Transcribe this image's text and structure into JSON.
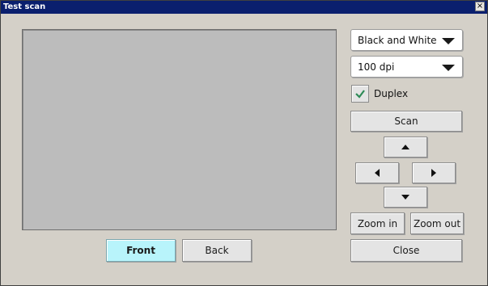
{
  "window": {
    "title": "Test scan",
    "close_glyph": "×"
  },
  "preview": {
    "label": "scan-preview-area"
  },
  "controls": {
    "color_mode": {
      "selected": "Black and White"
    },
    "resolution": {
      "selected": "100 dpi"
    },
    "duplex": {
      "label": "Duplex",
      "checked": true,
      "check_color": "#2e8b57"
    },
    "scan_label": "Scan",
    "zoom_in_label": "Zoom in",
    "zoom_out_label": "Zoom out",
    "close_label": "Close"
  },
  "side_buttons": {
    "front_label": "Front",
    "back_label": "Back"
  },
  "icons": [
    "close-icon",
    "dropdown-arrow-icon",
    "checkmark-icon",
    "arrow-up-icon",
    "arrow-down-icon",
    "arrow-left-icon",
    "arrow-right-icon"
  ],
  "colors": {
    "titlebar": "#0a1f6e",
    "front_active": "#b8f4fb",
    "window_bg": "#d4d0c8"
  }
}
